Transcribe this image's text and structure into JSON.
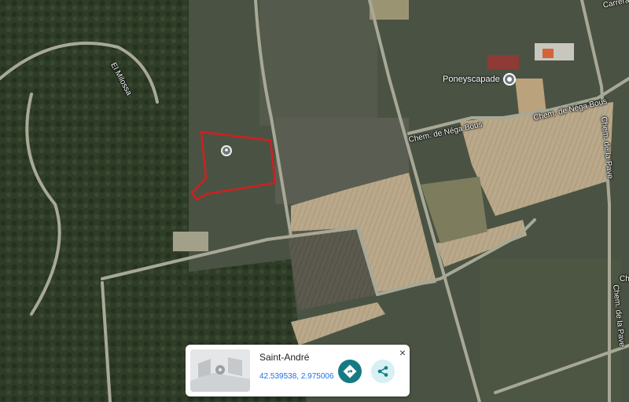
{
  "labels": {
    "carrera": "Carrera",
    "el_milossa": "El Milossa",
    "chem_nega_bous_1": "Chem. de Néga Bous",
    "chem_nega_bous_2": "Chem. de Néga Bous",
    "chem_pave_1": "Chem. de la Pave",
    "chem_pave_2": "Chem. de la Pave",
    "chem_edge": "Ch"
  },
  "poi": {
    "name": "Poneyscapade"
  },
  "card": {
    "title": "Saint-André",
    "coordinates": "42.539538, 2.975006",
    "close_glyph": "×"
  },
  "colors": {
    "parcel_outline": "#d21f1f",
    "directions_button": "#167a82",
    "share_button": "#d6f0f3",
    "coordinates_text": "#1a73e8"
  },
  "icons": {
    "parcel_marker": "map-pin-icon",
    "directions": "directions-icon",
    "share": "share-icon",
    "close": "close-icon"
  }
}
